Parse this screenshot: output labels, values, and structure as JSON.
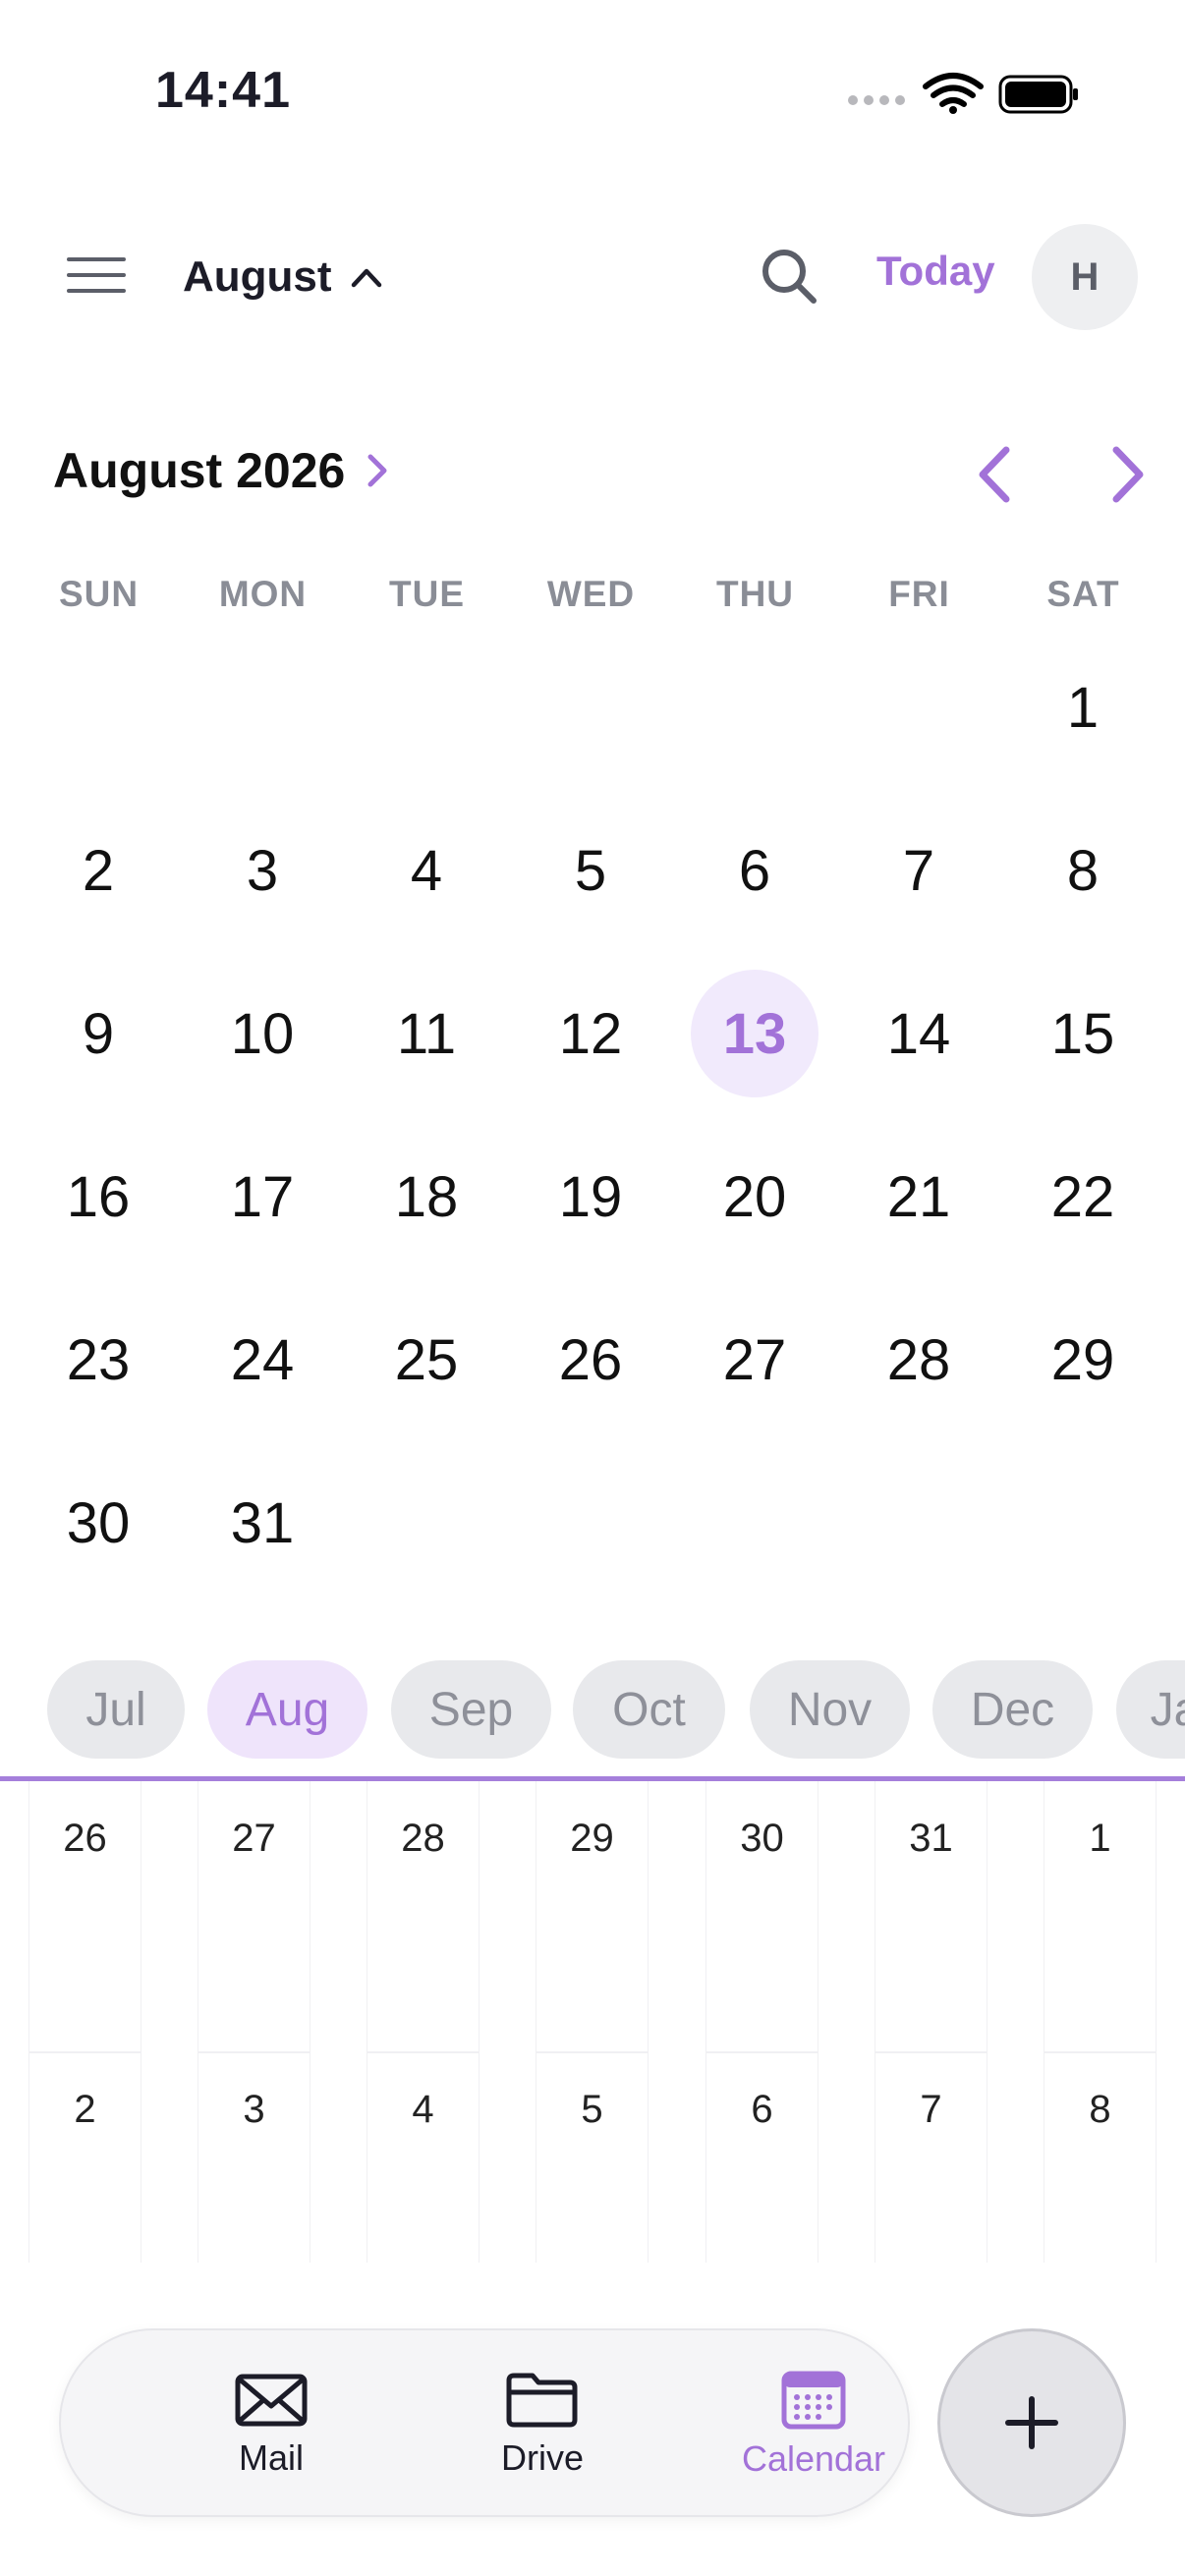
{
  "status_bar": {
    "time": "14:41"
  },
  "header": {
    "month_label": "August",
    "today_label": "Today",
    "avatar_initial": "H"
  },
  "calendar": {
    "heading": "August 2026",
    "weekdays": [
      "SUN",
      "MON",
      "TUE",
      "WED",
      "THU",
      "FRI",
      "SAT"
    ],
    "weeks": [
      [
        "",
        "",
        "",
        "",
        "",
        "",
        "1"
      ],
      [
        "2",
        "3",
        "4",
        "5",
        "6",
        "7",
        "8"
      ],
      [
        "9",
        "10",
        "11",
        "12",
        "13",
        "14",
        "15"
      ],
      [
        "16",
        "17",
        "18",
        "19",
        "20",
        "21",
        "22"
      ],
      [
        "23",
        "24",
        "25",
        "26",
        "27",
        "28",
        "29"
      ],
      [
        "30",
        "31",
        "",
        "",
        "",
        "",
        ""
      ]
    ],
    "selected_day": "13"
  },
  "month_chips": [
    "Jul",
    "Aug",
    "Sep",
    "Oct",
    "Nov",
    "Dec",
    "Ja"
  ],
  "active_month_chip": "Aug",
  "week_view": {
    "rows": [
      [
        "26",
        "27",
        "28",
        "29",
        "30",
        "31",
        "1"
      ],
      [
        "2",
        "3",
        "4",
        "5",
        "6",
        "7",
        "8"
      ]
    ]
  },
  "tabbar": {
    "tabs": [
      {
        "label": "Mail",
        "icon": "mail-icon"
      },
      {
        "label": "Drive",
        "icon": "folder-icon"
      },
      {
        "label": "Calendar",
        "icon": "calendar-icon"
      }
    ],
    "active_tab": "Calendar",
    "fab_icon": "plus-icon"
  },
  "colors": {
    "accent": "#a272d8",
    "today_bg": "#f1eafc",
    "chip_bg": "#e8e9ec",
    "chip_active_bg": "#efe4fb"
  }
}
